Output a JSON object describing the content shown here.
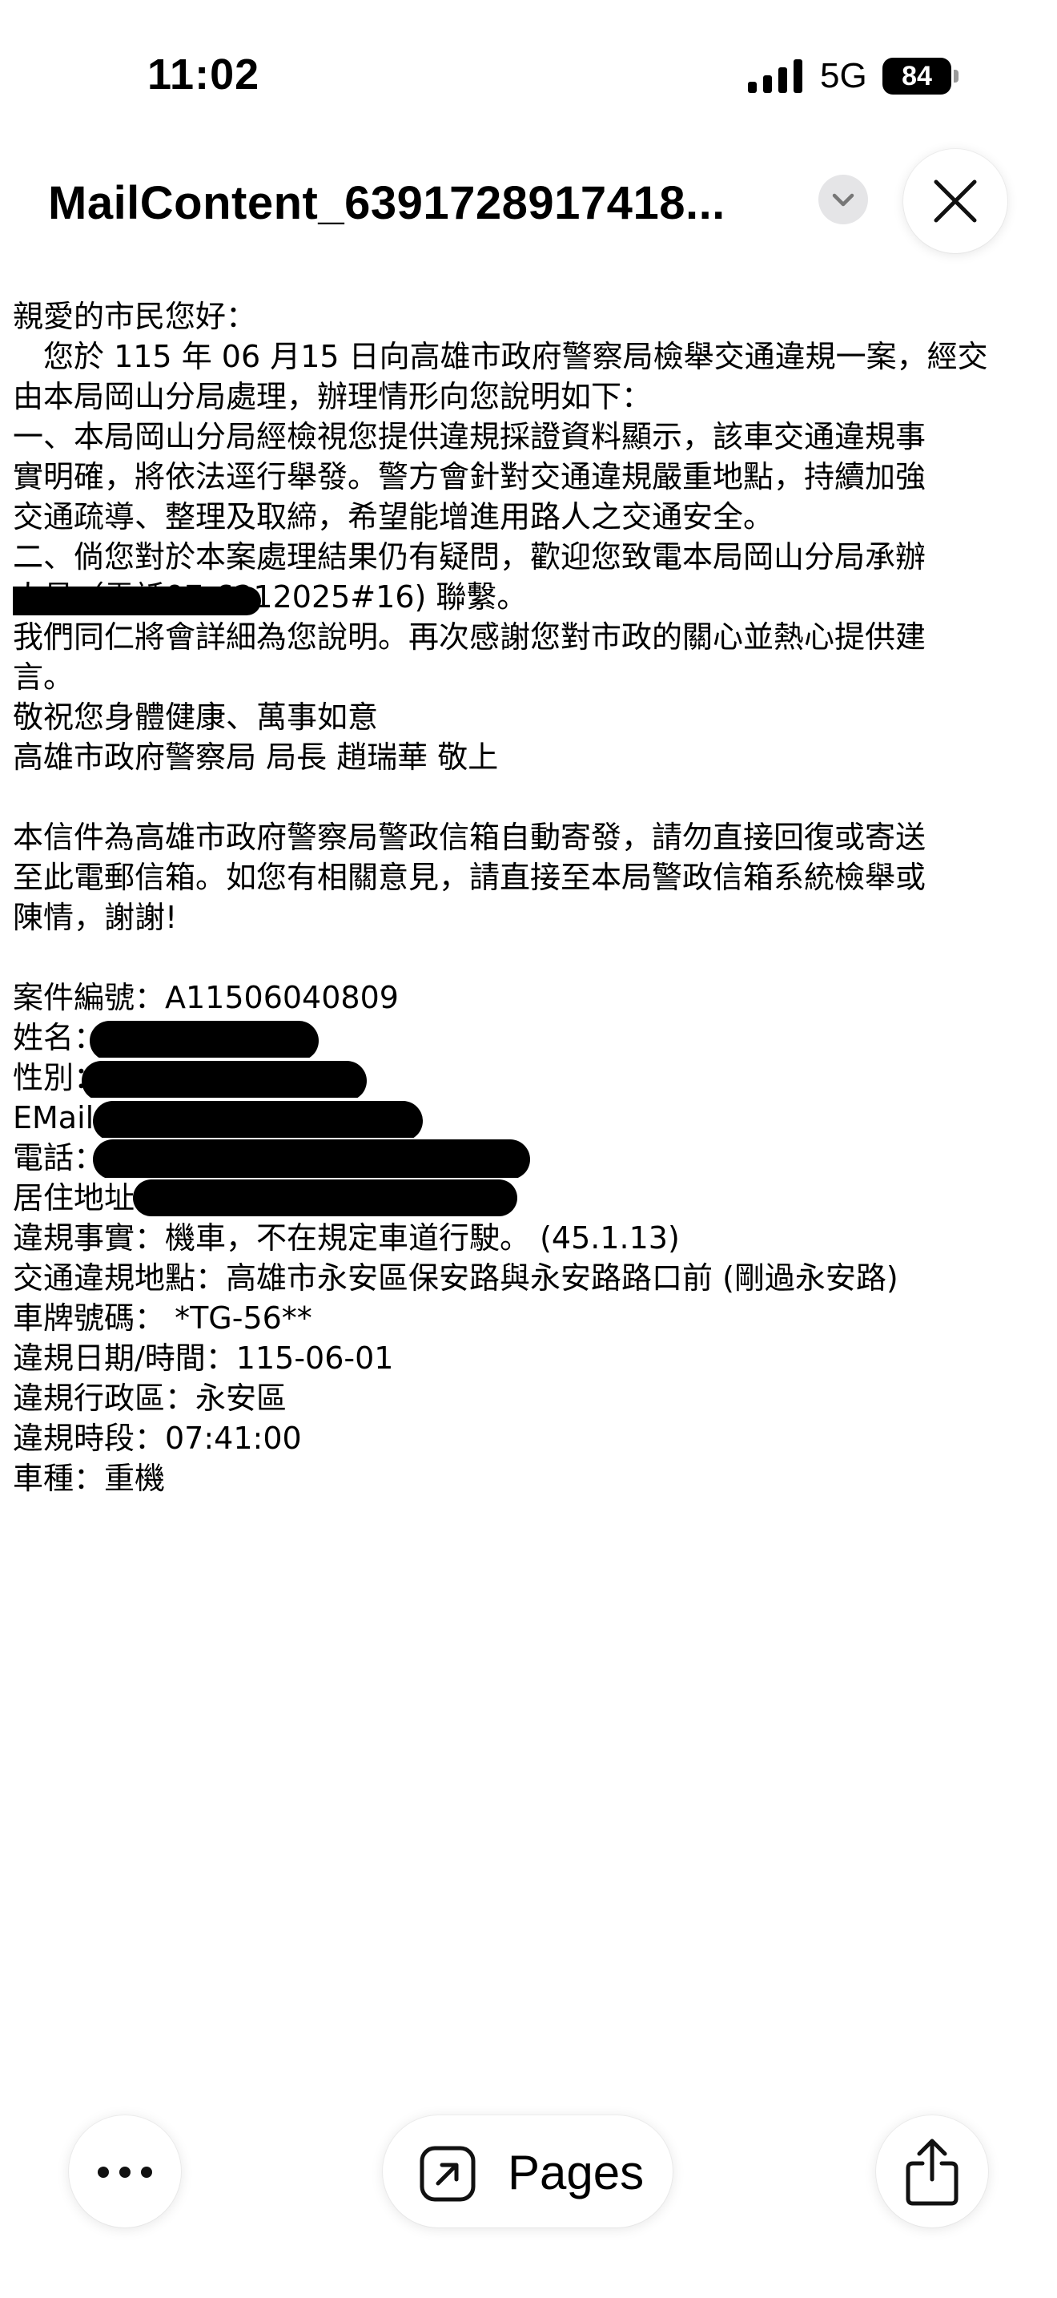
{
  "status_bar": {
    "time": "11:02",
    "network": "5G",
    "battery": "84",
    "signal_icon": "cellular-signal-icon"
  },
  "header": {
    "title": "MailContent_6391728917418..."
  },
  "mail": {
    "lines": [
      "親愛的市民您好：",
      "　您於 115 年 06 月15 日向高雄市政府警察局檢舉交通違規一案，經交",
      "由本局岡山分局處理，辦理情形向您說明如下：",
      "一、本局岡山分局經檢視您提供違規採證資料顯示，該車交通違規事",
      "實明確，將依法逕行舉發。警方會針對交通違規嚴重地點，持續加強",
      "交通疏導、整理及取締，希望能增進用路人之交通安全。",
      "二、倘您對於本案處理結果仍有疑問，歡迎您致電本局岡山分局承辦",
      "人員（電話07-6212025#16) 聯繫。",
      "我們同仁將會詳細為您說明。再次感謝您對市政的關心並熱心提供建",
      "言。",
      "敬祝您身體健康、萬事如意",
      "高雄市政府警察局 局長 趙瑞華 敬上",
      "",
      "本信件為高雄市政府警察局警政信箱自動寄發，請勿直接回復或寄送",
      "至此電郵信箱。如您有相關意見，請直接至本局警政信箱系統檢舉或",
      "陳情，謝謝!",
      "",
      "案件編號：A11506040809",
      "姓名：",
      "性別：",
      "EMail：",
      "電話：",
      "居住地址：",
      "違規事實：機車，不在規定車道行駛。 (45.1.13)",
      "交通違規地點：高雄市永安區保安路與永安路路口前 (剛過永安路)",
      "車牌號碼： *TG-56**",
      "違規日期/時間：115-06-01",
      "違規行政區：永安區",
      "違規時段：07:41:00",
      "車種：重機"
    ]
  },
  "toolbar": {
    "more_icon": "more-icon",
    "pages_label": "Pages",
    "pages_icon": "open-external-icon",
    "share_icon": "share-icon"
  }
}
